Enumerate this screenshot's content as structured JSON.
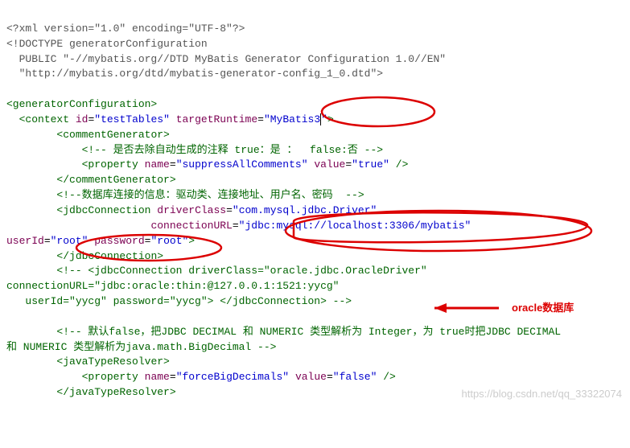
{
  "lines": {
    "l1_decl": "<?xml version=\"1.0\" encoding=\"UTF-8\"?>",
    "l2_decl": "<!DOCTYPE generatorConfiguration",
    "l3_decl": "  PUBLIC \"-//mybatis.org//DTD MyBatis Generator Configuration 1.0//EN\"",
    "l4_decl": "  \"http://mybatis.org/dtd/mybatis-generator-config_1_0.dtd\">",
    "l6_open": "<generatorConfiguration>",
    "l7_part1": "<context",
    "l7_attr1name": "id",
    "l7_attr1val": "\"testTables\"",
    "l7_attr2name": "targetRuntime",
    "l7_attr2val_a": "\"",
    "l7_attr2val_b": "MyBatis3",
    "l7_attr2val_c": "\"",
    "l7_close": ">",
    "l8_open": "<commentGenerator>",
    "l9_comment": "<!-- 是否去除自动生成的注释 true：是 ：  false:否 -->",
    "l10_part1": "<property",
    "l10_attr1name": "name",
    "l10_attr1val": "\"suppressAllComments\"",
    "l10_attr2name": "value",
    "l10_attr2val": "\"true\"",
    "l10_close": "/>",
    "l11_close": "</commentGenerator>",
    "l12_comment": "<!--数据库连接的信息：驱动类、连接地址、用户名、密码  -->",
    "l13_open": "<jdbcConnection",
    "l13_attr1name": "driverClass",
    "l13_attr1val": "\"com.mysql.jdbc.Driver\"",
    "l14_attr1name": "connectionURL",
    "l14_attr1val": "\"jdbc:mysql://localhost:3306/mybatis\"",
    "l15_attr1name": "userId",
    "l15_attr1val": "\"root\"",
    "l15_attr2name": "password",
    "l15_attr2val": "\"root\"",
    "l15_close": ">",
    "l16_close": "</jdbcConnection>",
    "l17_comment1": "<!-- <jdbcConnection driverClass=\"oracle.jdbc.OracleDriver\"",
    "l18_comment": "connectionURL=\"jdbc:oracle:thin:@127.0.0.1:1521:yycg\"",
    "l19_comment": "   userId=\"yycg\" password=\"yycg\"> </jdbcConnection> -->",
    "l21_comment1": "<!-- 默认false，把JDBC DECIMAL 和 NUMERIC 类型解析为 Integer，为 true时把JDBC DECIMAL",
    "l22_comment": "和 NUMERIC 类型解析为java.math.BigDecimal -->",
    "l23_open": "<javaTypeResolver>",
    "l24_part1": "<property",
    "l24_attr1name": "name",
    "l24_attr1val": "\"forceBigDecimals\"",
    "l24_attr2name": "value",
    "l24_attr2val": "\"false\"",
    "l24_close": "/>",
    "l25_close": "</javaTypeResolver>"
  },
  "annotation_label": "oracle数据库",
  "watermark": "https://blog.csdn.net/qq_33322074"
}
